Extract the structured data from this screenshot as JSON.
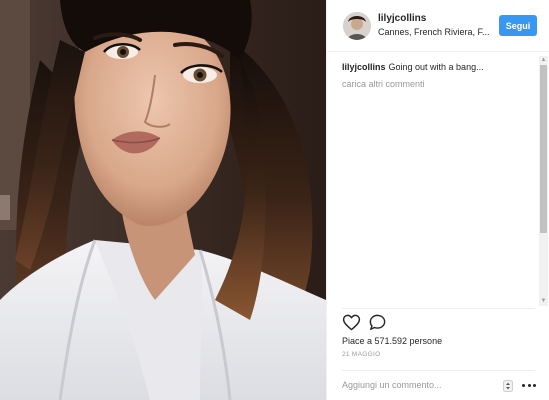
{
  "post": {
    "image_alt": "selfie of woman with bangs in white bathrobe",
    "author": {
      "username": "lilyjcollins",
      "location": "Cannes, French Riviera, F..."
    },
    "follow_label": "Segui",
    "caption": {
      "username": "lilyjcollins",
      "text": "Going out with a bang..."
    },
    "load_more_label": "carica altri commenti",
    "likes_text": "Piace a 571.592 persone",
    "date": "21 MAGGIO",
    "comment_placeholder": "Aggiungi un commento...",
    "icons": {
      "like": "heart-icon",
      "comment": "comment-bubble-icon",
      "avatar": "avatar",
      "more": "more-options-icon",
      "spinner": "spinner-arrows-icon"
    },
    "colors": {
      "follow_button": "#3897f0",
      "secondary_text": "#999999",
      "primary_text": "#262626",
      "divider": "#efefef"
    }
  }
}
